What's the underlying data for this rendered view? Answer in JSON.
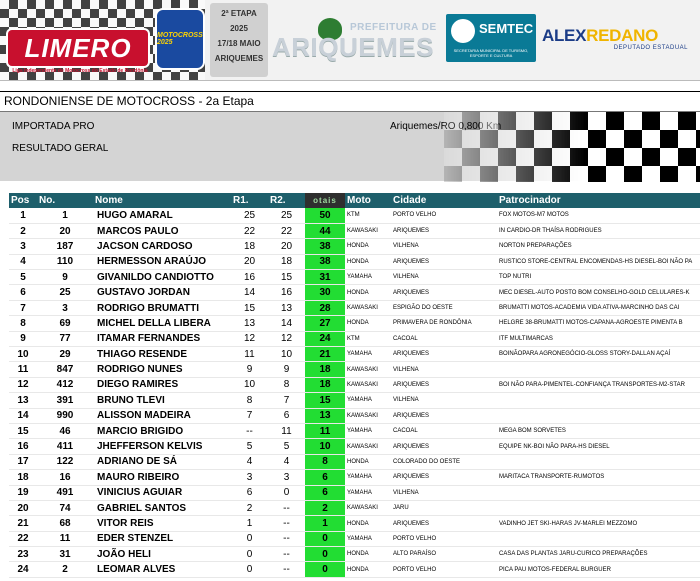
{
  "banner": {
    "limero_logo": "LIMERO",
    "limero_subtitle": "Liga Independente de Motocross do Estado de Rondônia",
    "motocross_logo": "MOTOCROSS 2025",
    "etapa": "2ª ETAPA",
    "year": "2025",
    "dates": "17/18 MAIO",
    "city_tag": "ARIQUEMES",
    "prefeitura_prefix": "PREFEITURA DE",
    "prefeitura_name": "ARIQUEMES",
    "semtec": "SEMTEC",
    "semtec_sub": "SECRETARIA MUNICIPAL DE TURISMO, ESPORTE E CULTURA",
    "sponsor_name_a": "ALEX",
    "sponsor_name_b": "REDANO",
    "sponsor_role": "DEPUTADO ESTADUAL"
  },
  "event_title": "RONDONIENSE DE MOTOCROSS - 2a Etapa",
  "category": {
    "name": "IMPORTADA PRO",
    "result_label": "RESULTADO GERAL",
    "venue": "Ariquemes/RO 0,800 Km"
  },
  "table": {
    "headers": [
      "Pos",
      "No.",
      "Nome",
      "R1.",
      "R2.",
      "otais",
      "Moto",
      "Cidade",
      "Patrocinador"
    ],
    "rows": [
      [
        "1",
        "1",
        "HUGO AMARAL",
        "25",
        "25",
        "50",
        "KTM",
        "PORTO VELHO",
        "FOX MOTOS-M7 MOTOS"
      ],
      [
        "2",
        "20",
        "MARCOS PAULO",
        "22",
        "22",
        "44",
        "KAWASAKI",
        "ARIQUEMES",
        "IN CARDIO-DR THAÍSA RODRIGUES"
      ],
      [
        "3",
        "187",
        "JACSON CARDOSO",
        "18",
        "20",
        "38",
        "HONDA",
        "VILHENA",
        "NORTON PREPARAÇÕES"
      ],
      [
        "4",
        "110",
        "HERMESSON ARAÚJO",
        "20",
        "18",
        "38",
        "HONDA",
        "ARIQUEMES",
        "RUSTICO STORE-CENTRAL ENCOMENDAS-HS DIESEL-BOI NÃO PA"
      ],
      [
        "5",
        "9",
        "GIVANILDO CANDIOTTO",
        "16",
        "15",
        "31",
        "YAMAHA",
        "VILHENA",
        "TOP NUTRI"
      ],
      [
        "6",
        "25",
        "GUSTAVO JORDAN",
        "14",
        "16",
        "30",
        "HONDA",
        "ARIQUEMES",
        "MEC DIESEL-AUTO POSTO BOM CONSELHO-GOLD CELULARES-K"
      ],
      [
        "7",
        "3",
        "RODRIGO BRUMATTI",
        "15",
        "13",
        "28",
        "KAWASAKI",
        "ESPIGÃO DO OESTE",
        "BRUMATTI MOTOS-ACADEMIA VIDA ATIVA-MARCINHO DAS CAI"
      ],
      [
        "8",
        "69",
        "MICHEL DELLA LIBERA",
        "13",
        "14",
        "27",
        "HONDA",
        "PRIMAVERA DE RONDÔNIA",
        "HELGRE 38-BRUMATTI MOTOS-CAPANA-AGROESTE PIMENTA B"
      ],
      [
        "9",
        "77",
        "ITAMAR FERNANDES",
        "12",
        "12",
        "24",
        "KTM",
        "CACOAL",
        "ITF MULTIMARCAS"
      ],
      [
        "10",
        "29",
        "THIAGO RESENDE",
        "11",
        "10",
        "21",
        "YAMAHA",
        "ARIQUEMES",
        "BOINÃOPARA AGRONEGÓCIO-GLOSS STORY-DALLAN AÇAÍ"
      ],
      [
        "11",
        "847",
        "RODRIGO NUNES",
        "9",
        "9",
        "18",
        "KAWASAKI",
        "VILHENA",
        ""
      ],
      [
        "12",
        "412",
        "DIEGO RAMIRES",
        "10",
        "8",
        "18",
        "KAWASAKI",
        "ARIQUEMES",
        "BOI NÃO PARA-PIMENTEL-CONFIANÇA TRANSPORTES-M2-STAR"
      ],
      [
        "13",
        "391",
        "BRUNO TLEVI",
        "8",
        "7",
        "15",
        "YAMAHA",
        "VILHENA",
        ""
      ],
      [
        "14",
        "990",
        "ALISSON MADEIRA",
        "7",
        "6",
        "13",
        "KAWASAKI",
        "ARIQUEMES",
        ""
      ],
      [
        "15",
        "46",
        "MARCIO BRIGIDO",
        "--",
        "11",
        "11",
        "YAMAHA",
        "CACOAL",
        "MEGA BOM SORVETES"
      ],
      [
        "16",
        "411",
        "JHEFFERSON KELVIS",
        "5",
        "5",
        "10",
        "KAWASAKI",
        "ARIQUEMES",
        "EQUIPE NK-BOI NÃO PARA-HS DIESEL"
      ],
      [
        "17",
        "122",
        "ADRIANO DE SÁ",
        "4",
        "4",
        "8",
        "HONDA",
        "COLORADO DO OESTE",
        ""
      ],
      [
        "18",
        "16",
        "MAURO RIBEIRO",
        "3",
        "3",
        "6",
        "YAMAHA",
        "ARIQUEMES",
        "MARITACA TRANSPORTE-RUMOTOS"
      ],
      [
        "19",
        "491",
        "VINICIUS AGUIAR",
        "6",
        "0",
        "6",
        "YAMAHA",
        "VILHENA",
        ""
      ],
      [
        "20",
        "74",
        "GABRIEL SANTOS",
        "2",
        "--",
        "2",
        "KAWASAKI",
        "JARU",
        ""
      ],
      [
        "21",
        "68",
        "VITOR REIS",
        "1",
        "--",
        "1",
        "HONDA",
        "ARIQUEMES",
        "VADINHO JET SKI-HARAS JV-MARLEI MEZZOMO"
      ],
      [
        "22",
        "11",
        "EDER STENZEL",
        "0",
        "--",
        "0",
        "YAMAHA",
        "PORTO VELHO",
        ""
      ],
      [
        "23",
        "31",
        "JOÃO HELI",
        "0",
        "--",
        "0",
        "HONDA",
        "ALTO PARAÍSO",
        "CASA DAS PLANTAS JARU-CURICO PREPARAÇÕES"
      ],
      [
        "24",
        "2",
        "LEOMAR ALVES",
        "0",
        "--",
        "0",
        "HONDA",
        "PORTO VELHO",
        "PICA PAU MOTOS-FEDERAL BURGUER"
      ]
    ]
  }
}
